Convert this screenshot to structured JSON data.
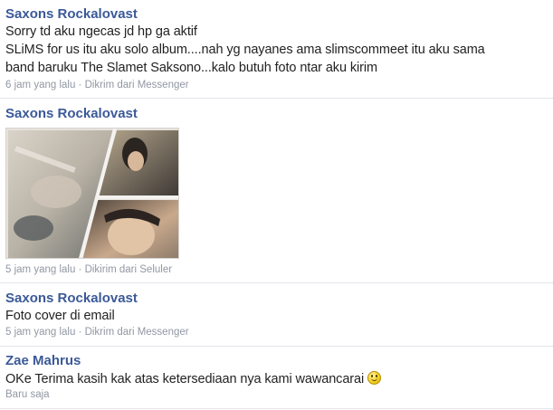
{
  "messages": [
    {
      "author": "Saxons Rockalovast",
      "lines": [
        "Sorry td aku ngecas jd hp ga aktif",
        "SLiMS for us itu aku solo album....nah yg nayanes ama slimscommeet itu aku sama",
        "band baruku The Slamet Saksono...kalo butuh foto ntar aku kirim"
      ],
      "meta": "6 jam yang lalu · Dikrim dari Messenger"
    },
    {
      "author": "Saxons Rockalovast",
      "attachment": "photo-collage",
      "meta": "5 jam yang lalu · Dikirim dari Seluler"
    },
    {
      "author": "Saxons Rockalovast",
      "lines": [
        "Foto cover di email"
      ],
      "meta": "5 jam yang lalu · Dikrim dari Messenger"
    },
    {
      "author": "Zae Mahrus",
      "lines": [
        "OKe Terima kasih kak atas ketersediaan nya kami wawancarai"
      ],
      "emoticon": "smiley-icon",
      "meta": "Baru saja"
    }
  ],
  "colors": {
    "author": "#3b5998",
    "text": "#222222",
    "meta": "#9197a3",
    "separator": "#e3e5ea"
  }
}
